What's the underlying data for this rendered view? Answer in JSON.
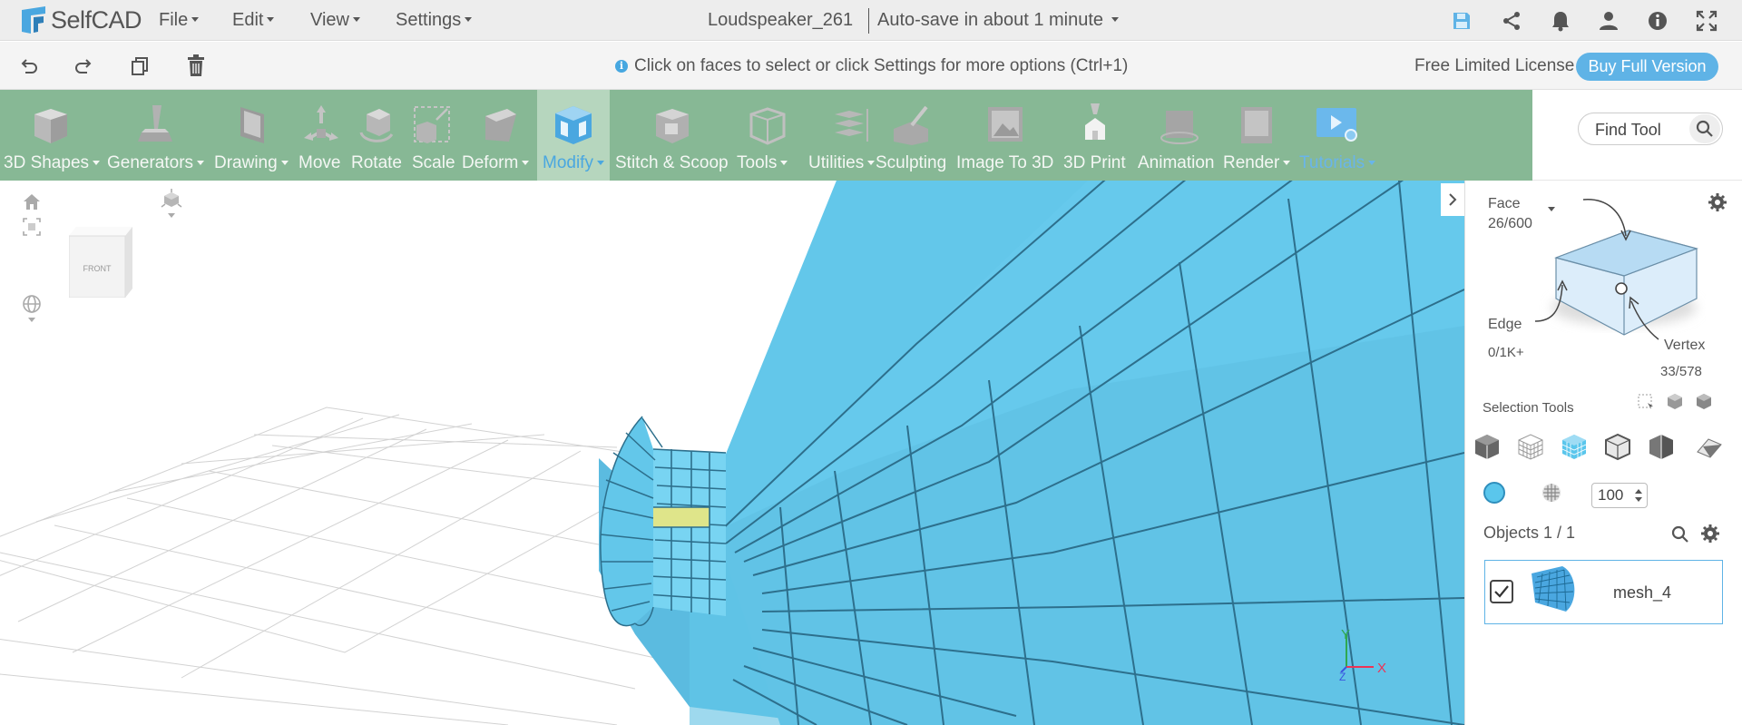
{
  "app": {
    "name": "SelfCAD"
  },
  "menu": [
    {
      "label": "File"
    },
    {
      "label": "Edit"
    },
    {
      "label": "View"
    },
    {
      "label": "Settings"
    }
  ],
  "project": {
    "title": "Loudspeaker_261",
    "autosave": "Auto-save in about 1 minute"
  },
  "top_icons": [
    "save-icon",
    "share-icon",
    "bell-icon",
    "user-icon",
    "info-icon",
    "fullscreen-icon"
  ],
  "subbar": {
    "icons": [
      "undo-icon",
      "redo-icon",
      "copy-icon",
      "trash-icon"
    ],
    "hint": "Click on faces to select or click Settings for more options (Ctrl+1)",
    "license": "Free Limited License",
    "buy_label": "Buy Full Version"
  },
  "tools": [
    {
      "label": "3D Shapes",
      "dropdown": true
    },
    {
      "label": "Generators",
      "dropdown": true
    },
    {
      "label": "Drawing",
      "dropdown": true
    },
    {
      "label": "Move",
      "dropdown": false
    },
    {
      "label": "Rotate",
      "dropdown": false
    },
    {
      "label": "Scale",
      "dropdown": false
    },
    {
      "label": "Deform",
      "dropdown": true
    },
    {
      "label": "Modify",
      "dropdown": true,
      "active": true
    },
    {
      "label": "Stitch & Scoop",
      "dropdown": false
    },
    {
      "label": "Tools",
      "dropdown": true
    },
    {
      "label": "Utilities",
      "dropdown": true
    },
    {
      "label": "Sculpting",
      "dropdown": false
    },
    {
      "label": "Image To 3D",
      "dropdown": false
    },
    {
      "label": "3D Print",
      "dropdown": false
    },
    {
      "label": "Animation",
      "dropdown": false
    },
    {
      "label": "Render",
      "dropdown": true
    },
    {
      "label": "Tutorials",
      "dropdown": true
    }
  ],
  "find_tool": {
    "placeholder": "Find Tool"
  },
  "viewport": {
    "view_cube_label": "FRONT",
    "axes": {
      "x": "X",
      "y": "Y",
      "z": "Z"
    }
  },
  "selection": {
    "face_label": "Face",
    "face_count": "26/600",
    "edge_label": "Edge",
    "edge_count": "0/1K+",
    "vertex_label": "Vertex",
    "vertex_count": "33/578",
    "tools_label": "Selection Tools",
    "opacity": "100"
  },
  "objects": {
    "header": "Objects 1 / 1",
    "items": [
      {
        "name": "mesh_4",
        "checked": true
      }
    ]
  },
  "colors": {
    "toolbar": "#87b895",
    "accent": "#5fb3e6",
    "mesh": "#63c7ea",
    "selected_face": "#dfe58a"
  }
}
